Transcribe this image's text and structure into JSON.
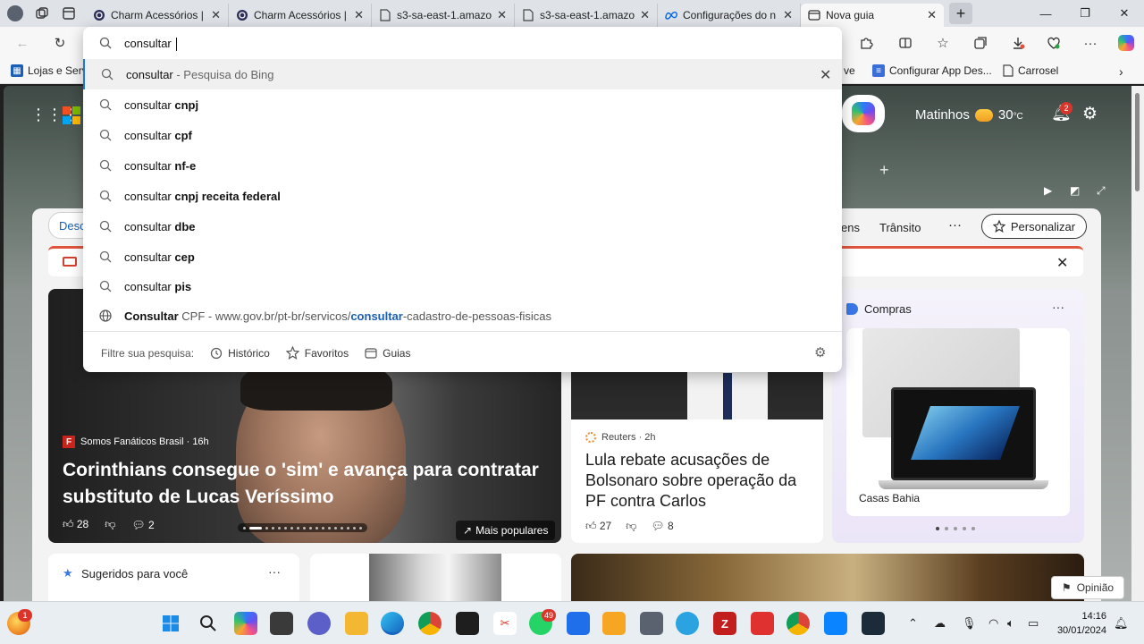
{
  "tabs": [
    {
      "title": "Charm Acessórios |",
      "icon": "charm-icon"
    },
    {
      "title": "Charm Acessórios |",
      "icon": "charm-icon"
    },
    {
      "title": "s3-sa-east-1.amazo",
      "icon": "document-icon"
    },
    {
      "title": "s3-sa-east-1.amazo",
      "icon": "document-icon"
    },
    {
      "title": "Configurações do n",
      "icon": "meta-icon"
    },
    {
      "title": "Nova guia",
      "icon": "newtab-icon",
      "active": true
    }
  ],
  "bookmarks": {
    "left_label": "Lojas e Serv",
    "partial_label": "ve",
    "configurar_label": "Configurar App Des...",
    "carrosel_label": "Carrosel"
  },
  "omnibox": {
    "value": "consultar ",
    "suggestions": [
      {
        "base": "consultar",
        "suffix": "",
        "hint": " - Pesquisa do Bing",
        "type": "search"
      },
      {
        "base": "consultar ",
        "suffix": "cnpj",
        "type": "search"
      },
      {
        "base": "consultar ",
        "suffix": "cpf",
        "type": "search"
      },
      {
        "base": "consultar ",
        "suffix": "nf-e",
        "type": "search"
      },
      {
        "base": "consultar ",
        "suffix": "cnpj receita federal",
        "type": "search"
      },
      {
        "base": "consultar ",
        "suffix": "dbe",
        "type": "search"
      },
      {
        "base": "consultar ",
        "suffix": "cep",
        "type": "search"
      },
      {
        "base": "consultar ",
        "suffix": "pis",
        "type": "search"
      }
    ],
    "site_suggestion": {
      "title_bold": "Consultar",
      "title_rest": " CPF",
      "url_pre": " - www.gov.br/pt-br/servicos/",
      "url_bold": "consultar",
      "url_post": "-cadastro-de-pessoas-fisicas"
    },
    "filter": {
      "label": "Filtre sua pesquisa:",
      "historico": "Histórico",
      "favoritos": "Favoritos",
      "guias": "Guias"
    }
  },
  "page": {
    "weather_city": "Matinhos",
    "weather_temp": "30",
    "weather_unit": "°C",
    "notifications": "2",
    "feed_tab_partial": "Desc",
    "nav_partial": "ens",
    "nav_transito": "Trânsito",
    "nav_more": "···",
    "personalize": "Personalizar",
    "hero": {
      "source": "Somos Fanáticos Brasil · 16h",
      "source_letter": "F",
      "title": "Corinthians consegue o 'sim' e avança para contratar substituto de Lucas Veríssimo",
      "likes": "28",
      "comments": "2",
      "mais_populares": "Mais populares"
    },
    "card2": {
      "source": "Reuters · 2h",
      "title": "Lula rebate acusações de Bolsonaro sobre operação da PF contra Carlos",
      "likes": "27",
      "comments": "8"
    },
    "shop": {
      "title": "Compras",
      "product_label": "Casas Bahia"
    },
    "suggested": {
      "title": "Sugeridos para você"
    },
    "opiniao": "Opinião"
  },
  "taskbar": {
    "time": "14:16",
    "date": "30/01/2024",
    "whatsapp_badge": "49",
    "widget_badge": "1"
  },
  "colors": {
    "accent": "#1a73e8",
    "ms_red": "#f25022",
    "ms_green": "#7fba00",
    "ms_blue": "#00a4ef",
    "ms_yellow": "#ffb900"
  }
}
